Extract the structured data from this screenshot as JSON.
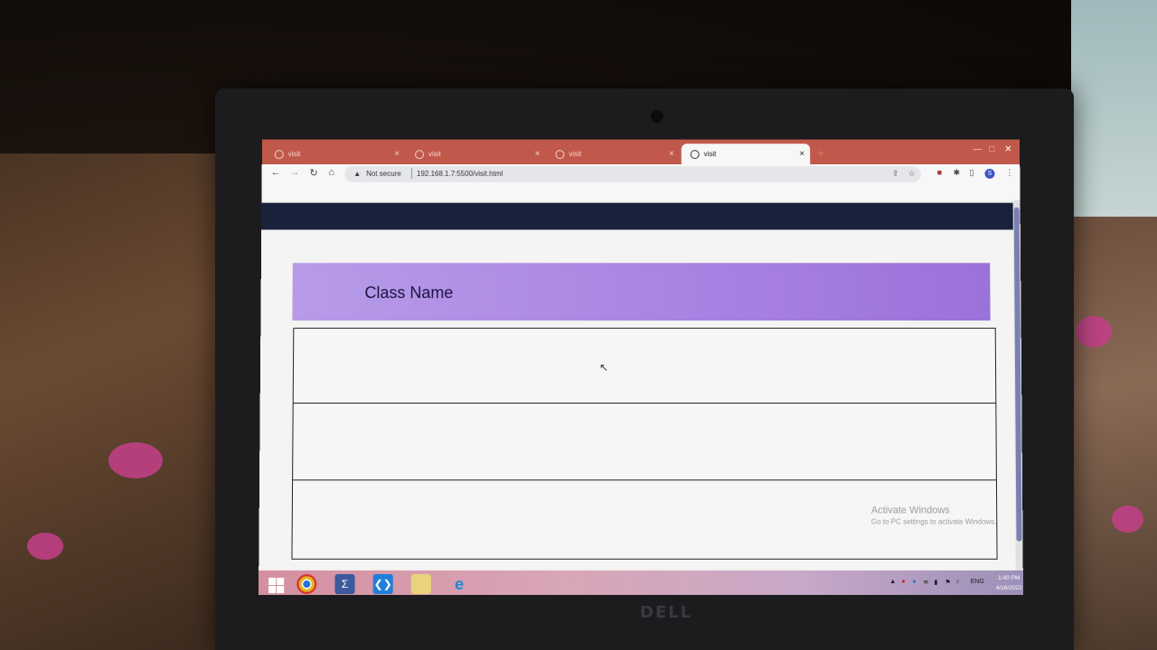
{
  "browser": {
    "tabs": [
      {
        "label": "visit",
        "active": false
      },
      {
        "label": "visit",
        "active": false
      },
      {
        "label": "visit",
        "active": false
      },
      {
        "label": "visit",
        "active": true
      }
    ],
    "close_glyph": "×",
    "new_tab_glyph": "+",
    "security_label": "Not secure",
    "url": "192.168.1.7:5500/visit.html",
    "icons": [
      "back-icon",
      "forward-icon",
      "reload-icon",
      "home-icon",
      "share-icon",
      "star-icon",
      "pdf-extension-icon",
      "extensions-icon",
      "sidebar-icon",
      "profile-icon",
      "menu-icon"
    ],
    "profile_initial": "S"
  },
  "page": {
    "class_header": "Class Name",
    "rows": [
      {
        "text": ""
      },
      {
        "text": ""
      },
      {
        "text": ""
      }
    ]
  },
  "windows_overlay": {
    "title": "Activate Windows",
    "subtitle": "Go to PC settings to activate Windows."
  },
  "taskbar": {
    "apps": [
      "start-icon",
      "chrome-icon",
      "powershell-icon",
      "vscode-icon",
      "file-explorer-icon",
      "internet-explorer-icon"
    ],
    "language": "ENG",
    "time": "1:40 PM",
    "date": "4/16/2022"
  },
  "colors": {
    "tabstrip": "#c0594b",
    "navbar": "#18223a",
    "class_header": "#a882e2",
    "header_text": "#1a1240"
  }
}
